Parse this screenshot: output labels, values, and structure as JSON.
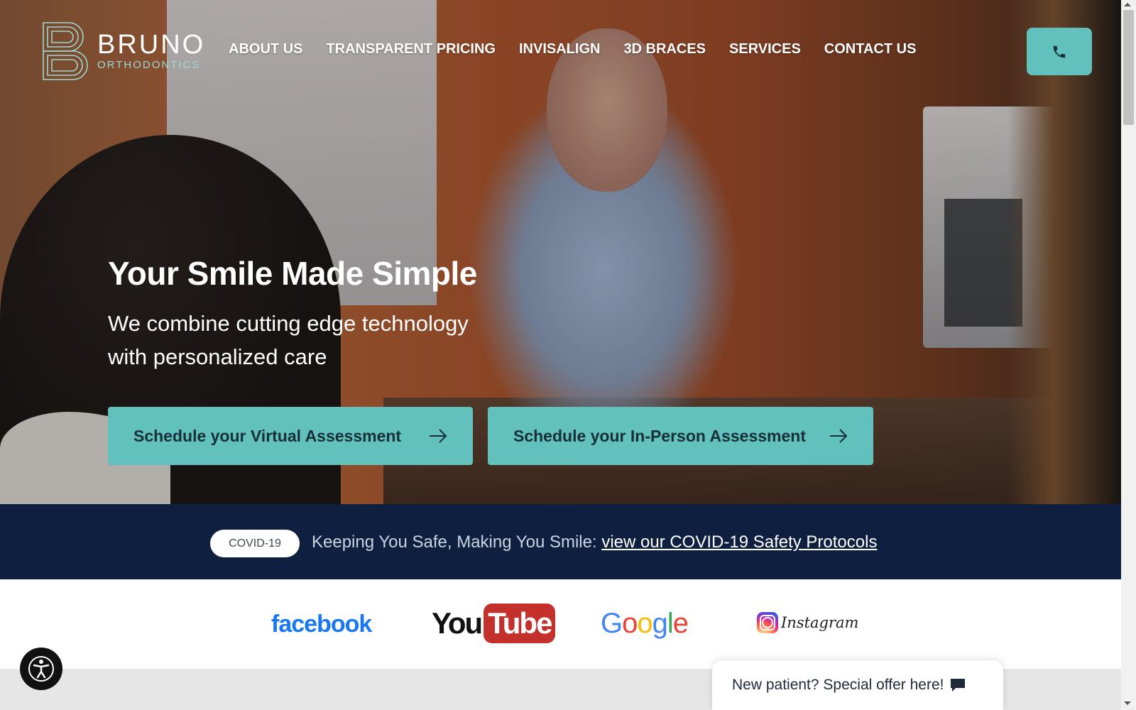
{
  "brand": {
    "name": "BRUNO",
    "sub": "ORTHODONTICS"
  },
  "nav": {
    "items": [
      {
        "label": "ABOUT US"
      },
      {
        "label": "TRANSPARENT PRICING"
      },
      {
        "label": "INVISALIGN"
      },
      {
        "label": "3D BRACES"
      },
      {
        "label": "SERVICES"
      },
      {
        "label": "CONTACT US"
      }
    ],
    "phone_icon": "phone-icon"
  },
  "hero": {
    "title": "Your Smile Made Simple",
    "subtitle": "We combine cutting edge technology with personalized care",
    "cta_virtual": "Schedule your Virtual Assessment",
    "cta_inperson": "Schedule your In-Person Assessment"
  },
  "covid": {
    "badge": "COVID-19",
    "text": "Keeping You Safe, Making You Smile: ",
    "link": "view our COVID-19 Safety Protocols"
  },
  "social": {
    "facebook": "facebook",
    "youtube_you": "You",
    "youtube_tube": "Tube",
    "google": [
      "G",
      "o",
      "o",
      "g",
      "l",
      "e"
    ],
    "instagram": "Instagram"
  },
  "offer": {
    "text": "New patient? Special offer here!",
    "icon": "chat-icon"
  },
  "colors": {
    "accent": "#62c0bd",
    "navy": "#0f1f40",
    "facebook": "#1877f2",
    "youtube": "#c4302b",
    "google": [
      "#4285f4",
      "#ea4335",
      "#fbbc05",
      "#4285f4",
      "#34a853",
      "#ea4335"
    ]
  }
}
